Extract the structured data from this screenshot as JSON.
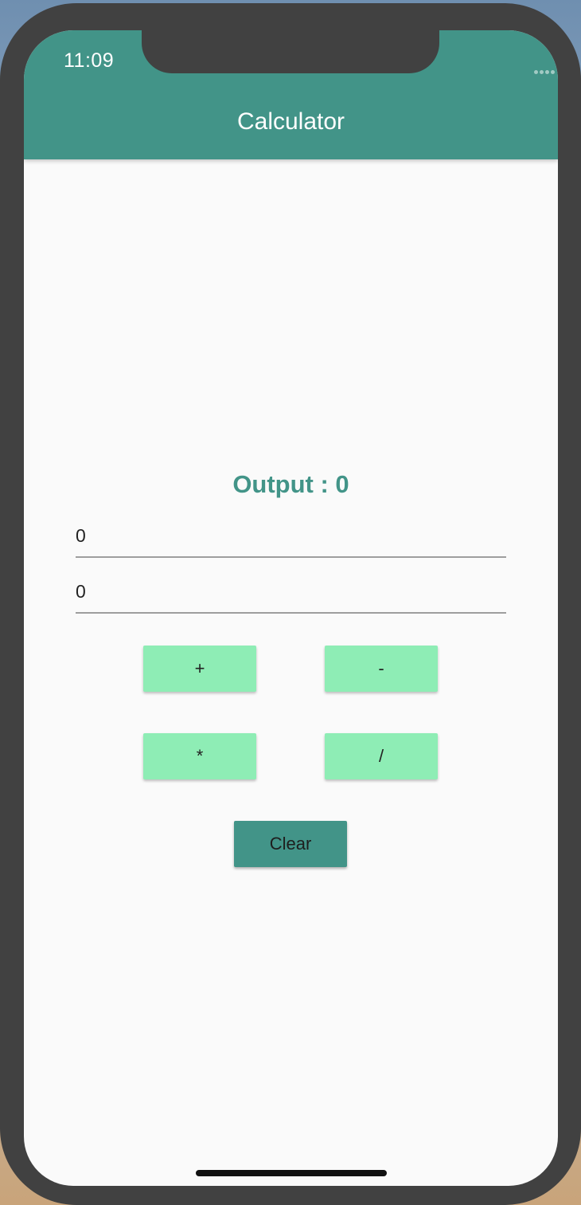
{
  "status_bar": {
    "time": "11:09",
    "icons": [
      "cellular-dots-icon",
      "wifi-icon",
      "battery-icon"
    ]
  },
  "app_bar": {
    "title": "Calculator"
  },
  "output": {
    "label": "Output : 0"
  },
  "inputs": {
    "first_value": "0",
    "second_value": "0"
  },
  "operations": {
    "add": "+",
    "subtract": "-",
    "multiply": "*",
    "divide": "/"
  },
  "clear_label": "Clear",
  "colors": {
    "primary": "#429488",
    "operation_button": "#8eedb5",
    "background": "#fafafa",
    "frame": "#414141"
  }
}
